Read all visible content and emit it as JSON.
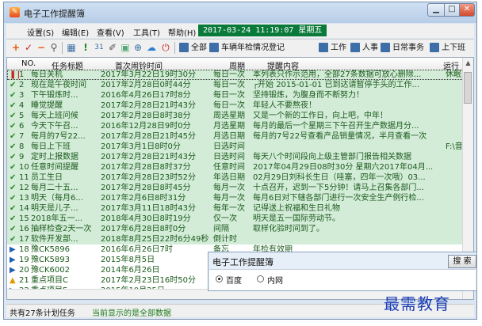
{
  "window": {
    "title": "电子工作提醒簿",
    "icon": "app-icon",
    "controls": {
      "minimize": "▁",
      "maximize": "□",
      "close": "✕"
    }
  },
  "menu": {
    "items": [
      "设置(S)",
      "编辑(E)",
      "查看(V)",
      "工具(T)",
      "帮助(H)"
    ],
    "clock": "2017-03-24 11:19:07 星期五"
  },
  "toolbar": {
    "icons": [
      "add-icon",
      "confirm-icon",
      "minus-icon",
      "search-icon",
      "calendar-icon",
      "stop-icon",
      "calendar-31-icon",
      "brush-icon",
      "image-icon",
      "magnify-icon",
      "cloud-icon",
      "power-icon"
    ],
    "categories": [
      "全部",
      "车辆年检情况登记",
      "工作",
      "人事",
      "日常事务",
      "上下班"
    ]
  },
  "grid": {
    "columns": [
      "NO.",
      "任务标题",
      "首次闹铃时间",
      "周期",
      "提醒内容",
      "运行"
    ],
    "rows": [
      {
        "status": "pause",
        "no": "1",
        "task": "每日关机",
        "time": "2017年3月22日19时30分",
        "cycle": "每日一次",
        "content": "本列表只作示范用，全部27条数据可放心删除...",
        "run": "休眠"
      },
      {
        "status": "check",
        "no": "2",
        "task": "现在是午夜时间",
        "time": "2017年2月28日0时44分",
        "cycle": "每日一次",
        "content": "┌开始 2015-01-01 已到达请暂停手头的工作...",
        "run": ""
      },
      {
        "status": "check",
        "no": "3",
        "task": "下午锻炼时...",
        "time": "2016年4月26日17时8分",
        "cycle": "每日一次",
        "content": "坚持锻炼，为腹身而不断努力！",
        "run": ""
      },
      {
        "status": "check",
        "no": "4",
        "task": "睡觉提醒",
        "time": "2017年2月28日21时43分",
        "cycle": "每日一次",
        "content": "年轻人不要熬夜！",
        "run": ""
      },
      {
        "status": "check",
        "no": "5",
        "task": "每天上班问候",
        "time": "2017年2月28日8时38分",
        "cycle": "周选星期",
        "content": "又是一个新的工作日，向上吧，中年！",
        "run": ""
      },
      {
        "status": "check",
        "no": "6",
        "task": "今天下午召...",
        "time": "2016年12月28日9时0分",
        "cycle": "月选星期",
        "content": "每月的最后一个星期三下午召开生产数据月分...",
        "run": ""
      },
      {
        "status": "check",
        "no": "7",
        "task": "每月的7号22...",
        "time": "2017年2月28日21时45分",
        "cycle": "月选日期",
        "content": "每月的7号22号查看产品销量情况，半月查看一次",
        "run": ""
      },
      {
        "status": "check",
        "no": "8",
        "task": "每日上下班",
        "time": "2017年3月1日8时0分",
        "cycle": "日选时间",
        "content": "",
        "run": "F:\\音乐"
      },
      {
        "status": "check",
        "no": "9",
        "task": "定时上报数据",
        "time": "2017年2月28日21时43分",
        "cycle": "日选时间",
        "content": "每天八个时间段向上级主管部门报告相关数据",
        "run": ""
      },
      {
        "status": "check",
        "no": "10",
        "task": "任意时间提醒",
        "time": "2017年2月28日8时37分",
        "cycle": "任意时间",
        "content": "2017年04月29日08时30分 星期六2017年04月...",
        "run": ""
      },
      {
        "status": "check",
        "no": "11",
        "task": "员工生日",
        "time": "2017年2月28日23时52分",
        "cycle": "年选日期",
        "content": "02月29日刘科长生日（哇塞，四年一次哦）03...",
        "run": ""
      },
      {
        "status": "check",
        "no": "12",
        "task": "每月二十五...",
        "time": "2017年2月28日8时45分",
        "cycle": "每月一次",
        "content": "十点召开，迟到一下5分钟！请马上召集各部门...",
        "run": ""
      },
      {
        "status": "check",
        "no": "13",
        "task": "明天（每月6...",
        "time": "2017年2月6日8时31分",
        "cycle": "每月一次",
        "content": "每月6日对下辖各部门进行一次安全生产例行检...",
        "run": ""
      },
      {
        "status": "check",
        "no": "14",
        "task": "明天是儿子...",
        "time": "2017年3月11日18时43分",
        "cycle": "每年一次",
        "content": "记得送上祝福和生日礼物",
        "run": ""
      },
      {
        "status": "check",
        "no": "15",
        "task": "2018年五一...",
        "time": "2018年4月30日8时19分",
        "cycle": "仅一次",
        "content": "明天是五一国际劳动节。",
        "run": ""
      },
      {
        "status": "check",
        "no": "16",
        "task": "抽样检查2天一次",
        "time": "2017年6月28日8时0分",
        "cycle": "间隔",
        "content": "取样化验时间到了。",
        "run": ""
      },
      {
        "status": "check",
        "no": "17",
        "task": "软件开发部...",
        "time": "2018年8月25日22时6分49秒",
        "cycle": "倒计时",
        "content": "",
        "run": ""
      },
      {
        "status": "play",
        "no": "18",
        "task": "豫CK5896",
        "time": "2016年6月26日7时",
        "cycle": "备忘",
        "content": "年检有效期",
        "run": ""
      },
      {
        "status": "play",
        "no": "19",
        "task": "豫CK5893",
        "time": "2015年8月5日",
        "cycle": "备忘",
        "content": "",
        "run": ""
      },
      {
        "status": "play",
        "no": "20",
        "task": "豫CK6002",
        "time": "2014年6月26日",
        "cycle": "备忘",
        "content": "",
        "run": ""
      },
      {
        "status": "warn",
        "no": "21",
        "task": "重点项目C",
        "time": "2017年2月23日16时50分",
        "cycle": "提醒",
        "content": "",
        "run": ""
      },
      {
        "status": "play",
        "no": "22",
        "task": "重点项目F",
        "time": "2015年10月25日",
        "cycle": "",
        "content": "",
        "run": ""
      }
    ]
  },
  "statusbar": {
    "total": "共有27条计划任务",
    "shown": "当前显示的是全部数据"
  },
  "popup": {
    "title": "电子工作提醒簿",
    "search_button": "搜 索",
    "options": [
      "百度",
      "内网"
    ],
    "selected": "百度"
  },
  "watermark": "最需教育"
}
